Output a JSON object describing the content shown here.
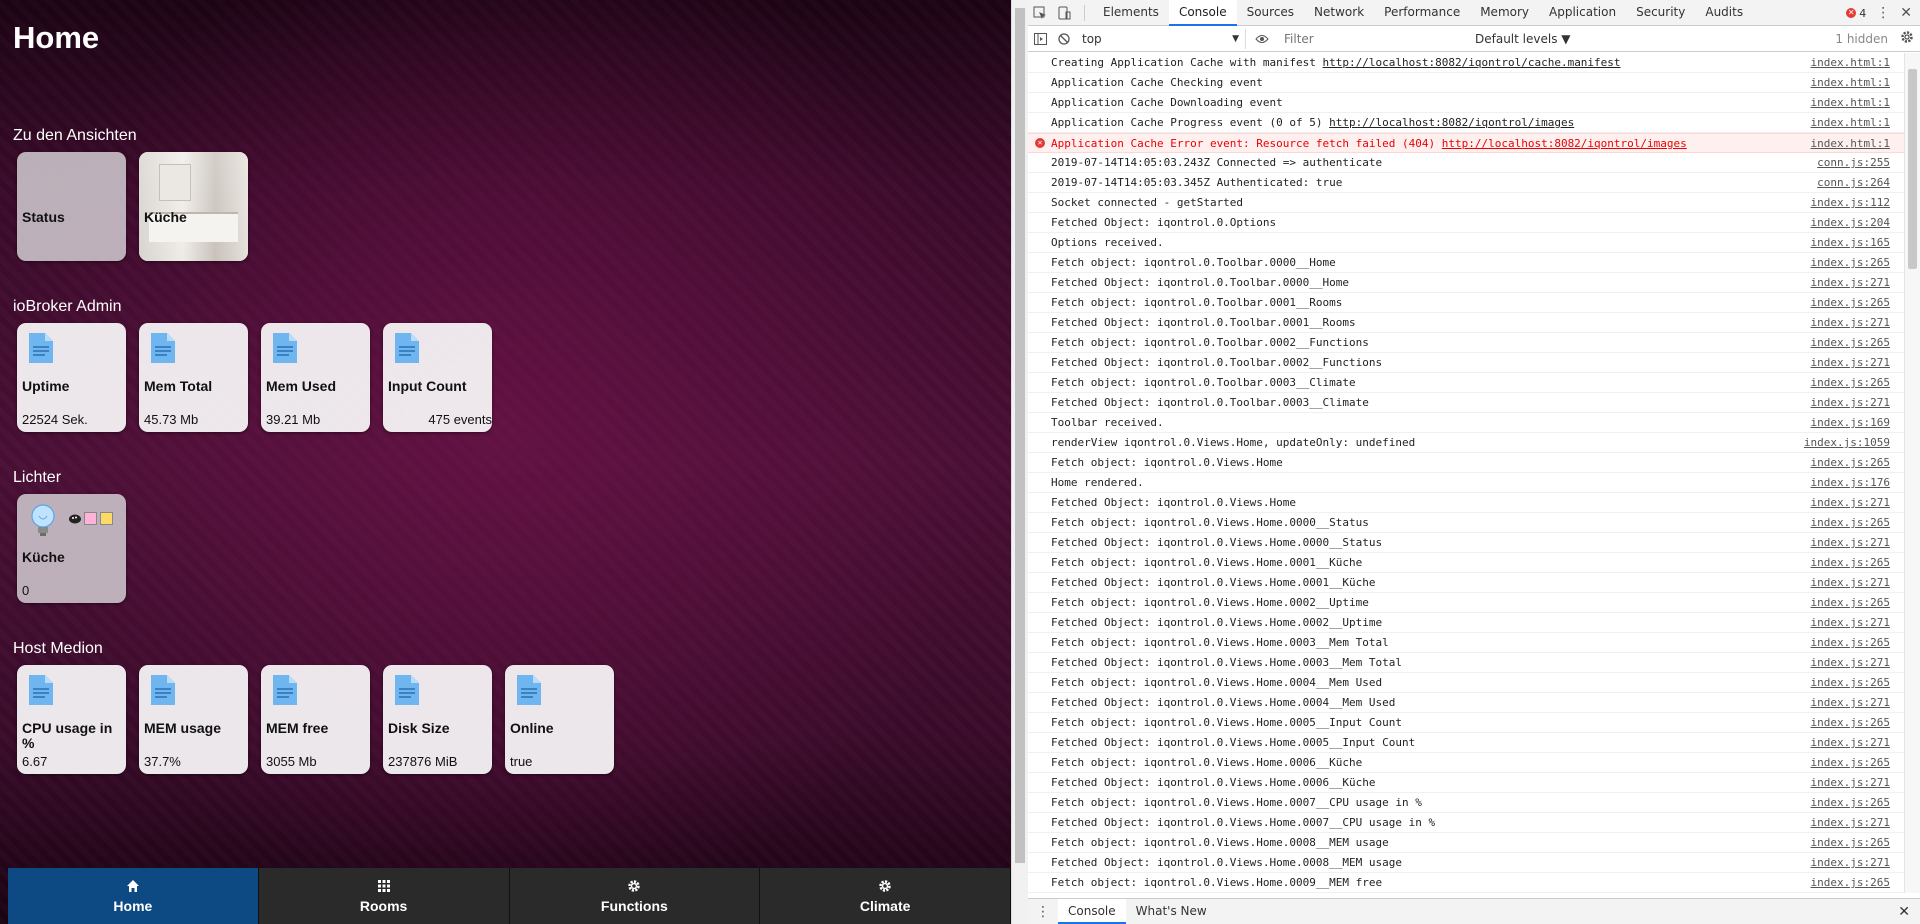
{
  "app": {
    "page_title": "Home",
    "sections": [
      {
        "title": "Zu den Ansichten"
      },
      {
        "title": "ioBroker Admin"
      },
      {
        "title": "Lichter"
      },
      {
        "title": "Host Medion"
      }
    ],
    "views_tiles": [
      {
        "name": "Status"
      },
      {
        "name": "Küche"
      }
    ],
    "admin_tiles": [
      {
        "name": "Uptime",
        "value": "22524 Sek."
      },
      {
        "name": "Mem Total",
        "value": "45.73 Mb"
      },
      {
        "name": "Mem Used",
        "value": "39.21 Mb"
      },
      {
        "name": "Input Count",
        "value": "475 events"
      }
    ],
    "light_tile": {
      "name": "Küche",
      "value": "0",
      "swatch_colors": [
        "#ffb3d9",
        "#ffd966"
      ]
    },
    "host_tiles": [
      {
        "name": "CPU usage in %",
        "value": "6.67"
      },
      {
        "name": "MEM usage",
        "value": "37.7%"
      },
      {
        "name": "MEM free",
        "value": "3055 Mb"
      },
      {
        "name": "Disk Size",
        "value": "237876 MiB"
      },
      {
        "name": "Online",
        "value": "true"
      }
    ],
    "nav": [
      {
        "label": "Home",
        "icon": "home-icon"
      },
      {
        "label": "Rooms",
        "icon": "grid-icon"
      },
      {
        "label": "Functions",
        "icon": "gear-icon"
      },
      {
        "label": "Climate",
        "icon": "gear-icon"
      }
    ]
  },
  "devtools": {
    "tabs": [
      "Elements",
      "Console",
      "Sources",
      "Network",
      "Performance",
      "Memory",
      "Application",
      "Security",
      "Audits"
    ],
    "error_count": "4",
    "context": "top",
    "filter_placeholder": "Filter",
    "levels_label": "Default levels ▼",
    "hidden_label": "1 hidden",
    "drawer_tabs": [
      "Console",
      "What's New"
    ],
    "logs": [
      {
        "text": "Creating Application Cache with manifest ",
        "link": "http://localhost:8082/iqontrol/cache.manifest",
        "src": "index.html:1"
      },
      {
        "text": "Application Cache Checking event",
        "src": "index.html:1"
      },
      {
        "text": "Application Cache Downloading event",
        "src": "index.html:1"
      },
      {
        "text": "Application Cache Progress event (0 of 5) ",
        "link": "http://localhost:8082/iqontrol/images",
        "src": "index.html:1"
      },
      {
        "text": "Application Cache Error event: Resource fetch failed (404) ",
        "link": "http://localhost:8082/iqontrol/images",
        "src": "index.html:1",
        "level": "error"
      },
      {
        "text": "2019-07-14T14:05:03.243Z Connected => authenticate",
        "src": "conn.js:255"
      },
      {
        "text": "2019-07-14T14:05:03.345Z Authenticated: true",
        "src": "conn.js:264"
      },
      {
        "text": "Socket connected - getStarted",
        "src": "index.js:112"
      },
      {
        "text": "Fetched Object: iqontrol.0.Options",
        "src": "index.js:204"
      },
      {
        "text": "Options received.",
        "src": "index.js:165"
      },
      {
        "text": "Fetch object: iqontrol.0.Toolbar.0000__Home",
        "src": "index.js:265"
      },
      {
        "text": "Fetched Object: iqontrol.0.Toolbar.0000__Home",
        "src": "index.js:271"
      },
      {
        "text": "Fetch object: iqontrol.0.Toolbar.0001__Rooms",
        "src": "index.js:265"
      },
      {
        "text": "Fetched Object: iqontrol.0.Toolbar.0001__Rooms",
        "src": "index.js:271"
      },
      {
        "text": "Fetch object: iqontrol.0.Toolbar.0002__Functions",
        "src": "index.js:265"
      },
      {
        "text": "Fetched Object: iqontrol.0.Toolbar.0002__Functions",
        "src": "index.js:271"
      },
      {
        "text": "Fetch object: iqontrol.0.Toolbar.0003__Climate",
        "src": "index.js:265"
      },
      {
        "text": "Fetched Object: iqontrol.0.Toolbar.0003__Climate",
        "src": "index.js:271"
      },
      {
        "text": "Toolbar received.",
        "src": "index.js:169"
      },
      {
        "text": "renderView iqontrol.0.Views.Home, updateOnly: undefined",
        "src": "index.js:1059"
      },
      {
        "text": "Fetch object: iqontrol.0.Views.Home",
        "src": "index.js:265"
      },
      {
        "text": "Home rendered.",
        "src": "index.js:176"
      },
      {
        "text": "Fetched Object: iqontrol.0.Views.Home",
        "src": "index.js:271"
      },
      {
        "text": "Fetch object: iqontrol.0.Views.Home.0000__Status",
        "src": "index.js:265"
      },
      {
        "text": "Fetched Object: iqontrol.0.Views.Home.0000__Status",
        "src": "index.js:271"
      },
      {
        "text": "Fetch object: iqontrol.0.Views.Home.0001__Küche",
        "src": "index.js:265"
      },
      {
        "text": "Fetched Object: iqontrol.0.Views.Home.0001__Küche",
        "src": "index.js:271"
      },
      {
        "text": "Fetch object: iqontrol.0.Views.Home.0002__Uptime",
        "src": "index.js:265"
      },
      {
        "text": "Fetched Object: iqontrol.0.Views.Home.0002__Uptime",
        "src": "index.js:271"
      },
      {
        "text": "Fetch object: iqontrol.0.Views.Home.0003__Mem Total",
        "src": "index.js:265"
      },
      {
        "text": "Fetched Object: iqontrol.0.Views.Home.0003__Mem Total",
        "src": "index.js:271"
      },
      {
        "text": "Fetch object: iqontrol.0.Views.Home.0004__Mem Used",
        "src": "index.js:265"
      },
      {
        "text": "Fetched Object: iqontrol.0.Views.Home.0004__Mem Used",
        "src": "index.js:271"
      },
      {
        "text": "Fetch object: iqontrol.0.Views.Home.0005__Input Count",
        "src": "index.js:265"
      },
      {
        "text": "Fetched Object: iqontrol.0.Views.Home.0005__Input Count",
        "src": "index.js:271"
      },
      {
        "text": "Fetch object: iqontrol.0.Views.Home.0006__Küche",
        "src": "index.js:265"
      },
      {
        "text": "Fetched Object: iqontrol.0.Views.Home.0006__Küche",
        "src": "index.js:271"
      },
      {
        "text": "Fetch object: iqontrol.0.Views.Home.0007__CPU usage in %",
        "src": "index.js:265"
      },
      {
        "text": "Fetched Object: iqontrol.0.Views.Home.0007__CPU usage in %",
        "src": "index.js:271"
      },
      {
        "text": "Fetch object: iqontrol.0.Views.Home.0008__MEM usage",
        "src": "index.js:265"
      },
      {
        "text": "Fetched Object: iqontrol.0.Views.Home.0008__MEM usage",
        "src": "index.js:271"
      },
      {
        "text": "Fetch object: iqontrol.0.Views.Home.0009__MEM free",
        "src": "index.js:265"
      }
    ]
  }
}
